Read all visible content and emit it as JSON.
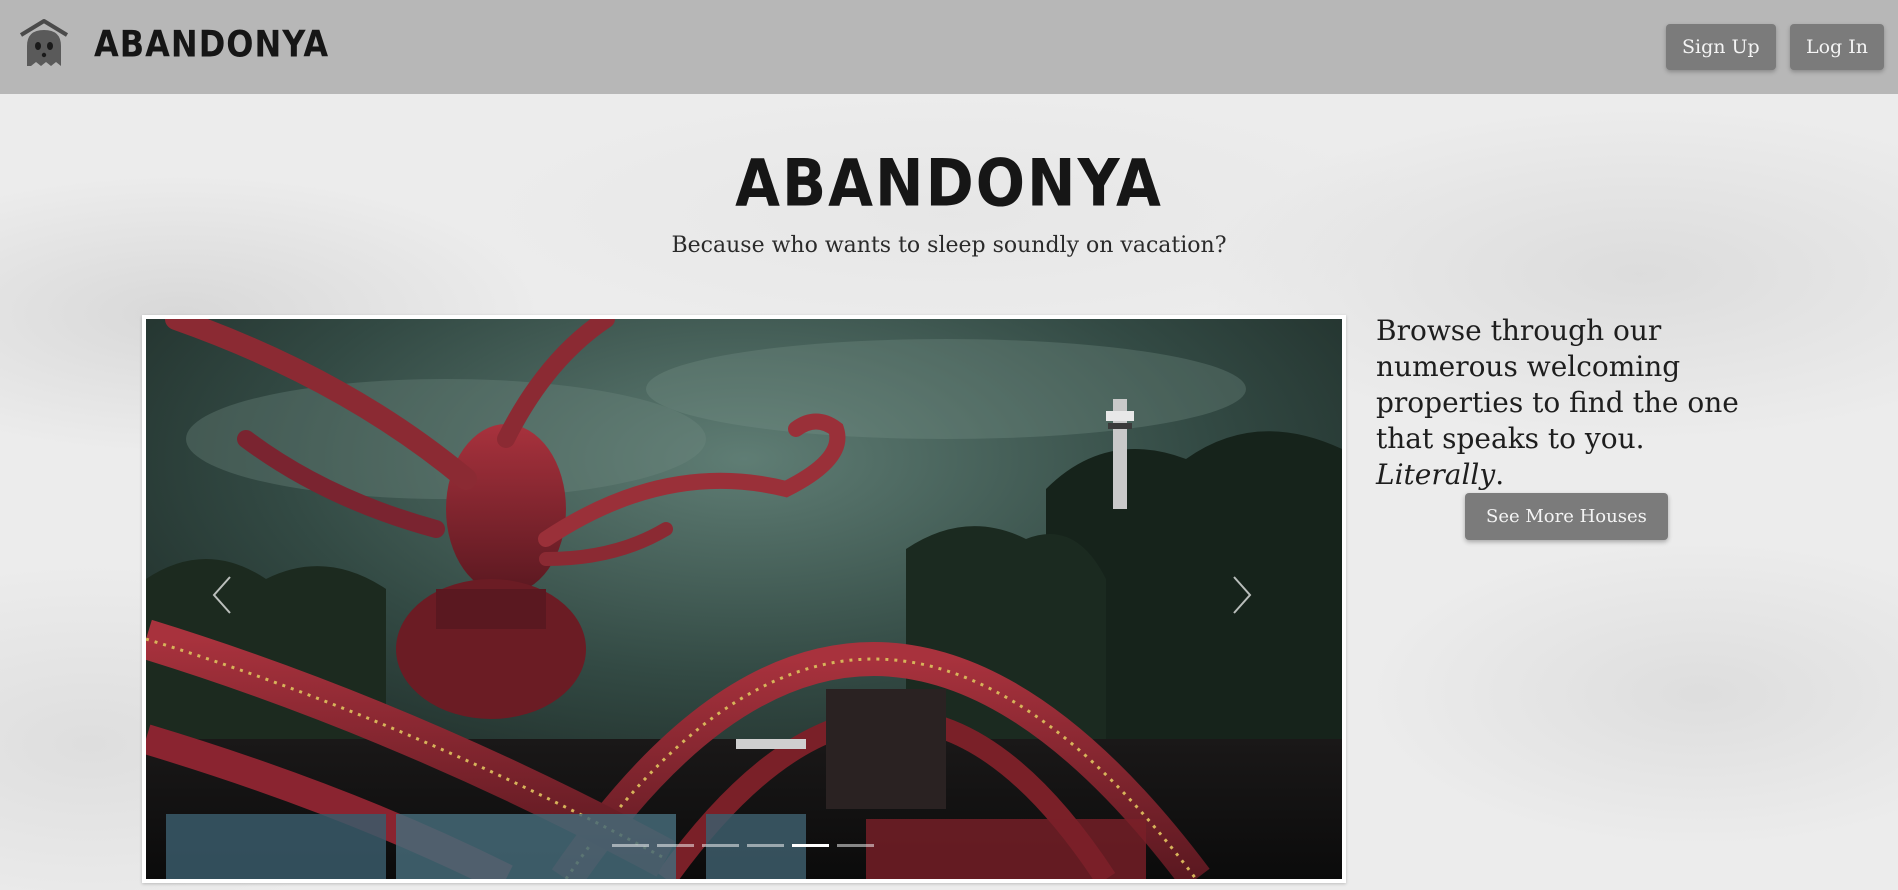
{
  "navbar": {
    "brand": "ABANDONYA",
    "logo_icon": "ghost-house-icon",
    "signup_label": "Sign Up",
    "login_label": "Log In"
  },
  "hero": {
    "title": "ABANDONYA",
    "tagline": "Because who wants to sleep soundly on vacation?"
  },
  "carousel": {
    "image_icon": "abandoned-octopus-ride-photo",
    "prev_icon": "chevron-left-icon",
    "next_icon": "chevron-right-icon",
    "slide_count": 6,
    "active_slide": 5
  },
  "side": {
    "text": "Browse through our numerous welcoming properties to find the one that speaks to you.",
    "emphasis": "Literally",
    "emphasis_suffix": ".",
    "button_label": "See More Houses"
  },
  "colors": {
    "navbar_bg": "#b7b7b7",
    "button_bg": "#7b7b7b",
    "page_bg": "#ececec"
  }
}
